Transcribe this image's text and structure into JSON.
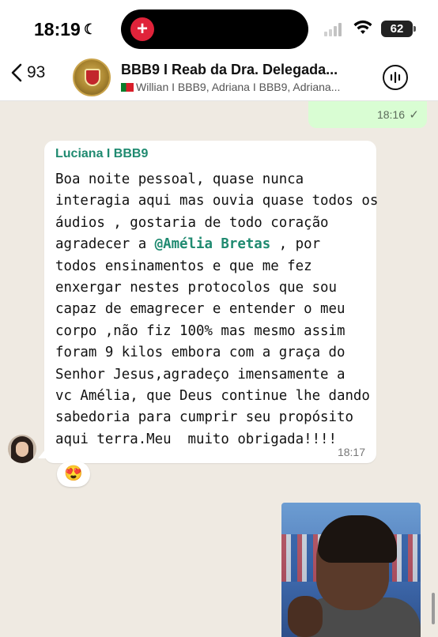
{
  "status_bar": {
    "time": "18:19",
    "battery": "62"
  },
  "header": {
    "back_count": "93",
    "title": "BBB9 I Reab da Dra. Delegada...",
    "members": "Willian I BBB9, Adriana I BBB9, Adriana..."
  },
  "messages": {
    "outgoing": {
      "time": "18:16",
      "status": "✓"
    },
    "incoming": {
      "sender": "Luciana I BBB9",
      "lines": [
        "Boa noite pessoal, quase nunca",
        "interagia aqui mas ouvia quase todos os",
        "áudios , gostaria de todo coração",
        "agradecer a ",
        "todos ensinamentos e que me fez",
        "enxergar nestes protocolos que sou",
        "capaz de emagrecer e entender o meu",
        "corpo ,não fiz 100% mas mesmo assim",
        "foram 9 kilos embora com a graça do",
        "Senhor Jesus,agradeço imensamente a",
        "vc Amélia, que Deus continue lhe dando",
        "sabedoria para cumprir seu propósito",
        "aqui terra.Meu  muito obrigada!!!!"
      ],
      "mention": "@Amélia Bretas",
      "mention_suffix": " , por",
      "time": "18:17",
      "reaction": "😍"
    }
  },
  "colors": {
    "accent_green": "#1f8a70",
    "outgoing_bubble": "#d9fdd3",
    "chat_background": "#efeae2"
  }
}
